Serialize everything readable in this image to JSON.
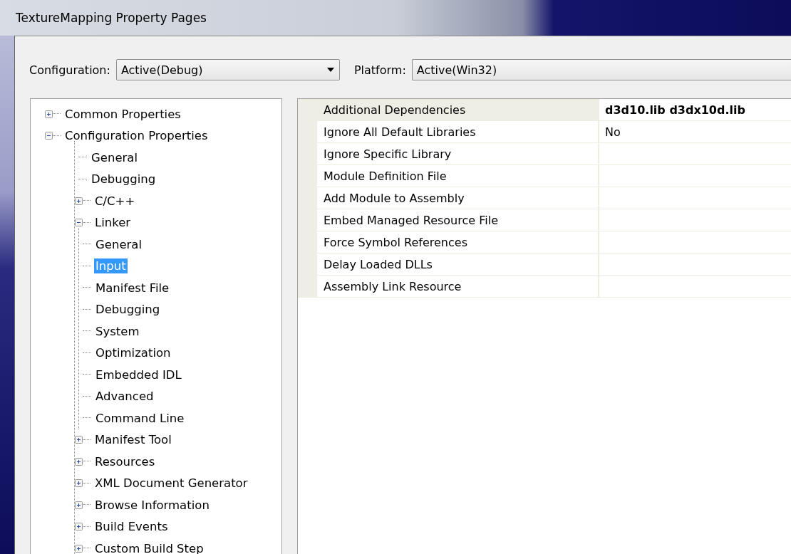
{
  "window": {
    "title": "TextureMapping Property Pages"
  },
  "configuration": {
    "label": "Configuration:",
    "value": "Active(Debug)"
  },
  "platform": {
    "label": "Platform:",
    "value": "Active(Win32)"
  },
  "tree": [
    {
      "label": "Common Properties",
      "expanded": false,
      "selected": false
    },
    {
      "label": "Configuration Properties",
      "expanded": true,
      "selected": false,
      "children": [
        {
          "label": "General",
          "selected": false
        },
        {
          "label": "Debugging",
          "selected": false
        },
        {
          "label": "C/C++",
          "expanded": false,
          "selected": false
        },
        {
          "label": "Linker",
          "expanded": true,
          "selected": false,
          "children": [
            {
              "label": "General",
              "selected": false
            },
            {
              "label": "Input",
              "selected": true
            },
            {
              "label": "Manifest File",
              "selected": false
            },
            {
              "label": "Debugging",
              "selected": false
            },
            {
              "label": "System",
              "selected": false
            },
            {
              "label": "Optimization",
              "selected": false
            },
            {
              "label": "Embedded IDL",
              "selected": false
            },
            {
              "label": "Advanced",
              "selected": false
            },
            {
              "label": "Command Line",
              "selected": false
            }
          ]
        },
        {
          "label": "Manifest Tool",
          "expanded": false,
          "selected": false
        },
        {
          "label": "Resources",
          "expanded": false,
          "selected": false
        },
        {
          "label": "XML Document Generator",
          "expanded": false,
          "selected": false
        },
        {
          "label": "Browse Information",
          "expanded": false,
          "selected": false
        },
        {
          "label": "Build Events",
          "expanded": false,
          "selected": false
        },
        {
          "label": "Custom Build Step",
          "expanded": false,
          "selected": false
        }
      ]
    }
  ],
  "properties": [
    {
      "name": "Additional Dependencies",
      "value": "d3d10.lib d3dx10d.lib",
      "selected": true
    },
    {
      "name": "Ignore All Default Libraries",
      "value": "No",
      "selected": false
    },
    {
      "name": "Ignore Specific Library",
      "selected": false
    },
    {
      "name": "Module Definition File",
      "selected": false
    },
    {
      "name": "Add Module to Assembly",
      "selected": false
    },
    {
      "name": "Embed Managed Resource File",
      "selected": false
    },
    {
      "name": "Force Symbol References",
      "selected": false
    },
    {
      "name": "Delay Loaded DLLs",
      "selected": false
    },
    {
      "name": "Assembly Link Resource",
      "selected": false
    }
  ]
}
